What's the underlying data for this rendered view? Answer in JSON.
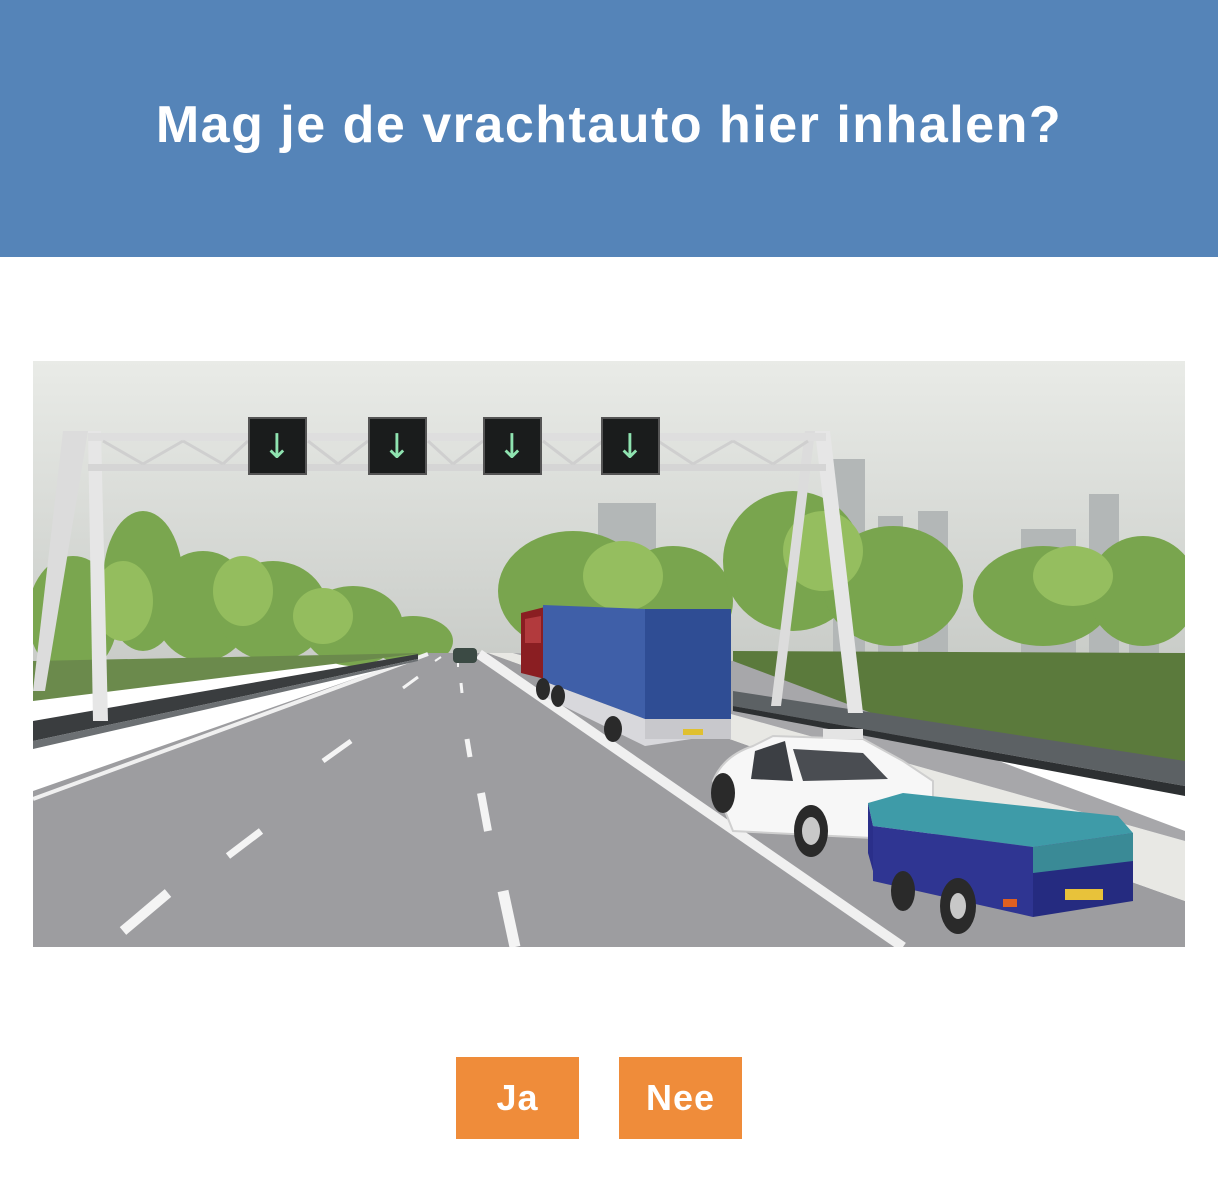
{
  "question": {
    "title": "Mag je de vrachtauto hier inhalen?"
  },
  "scene": {
    "lane_signals": [
      "↓",
      "↓",
      "↓",
      "↓"
    ],
    "signal_color": "#8fe3b0"
  },
  "answers": {
    "yes_label": "Ja",
    "no_label": "Nee"
  },
  "colors": {
    "header": "#5584b8",
    "button": "#ef8c3a"
  }
}
